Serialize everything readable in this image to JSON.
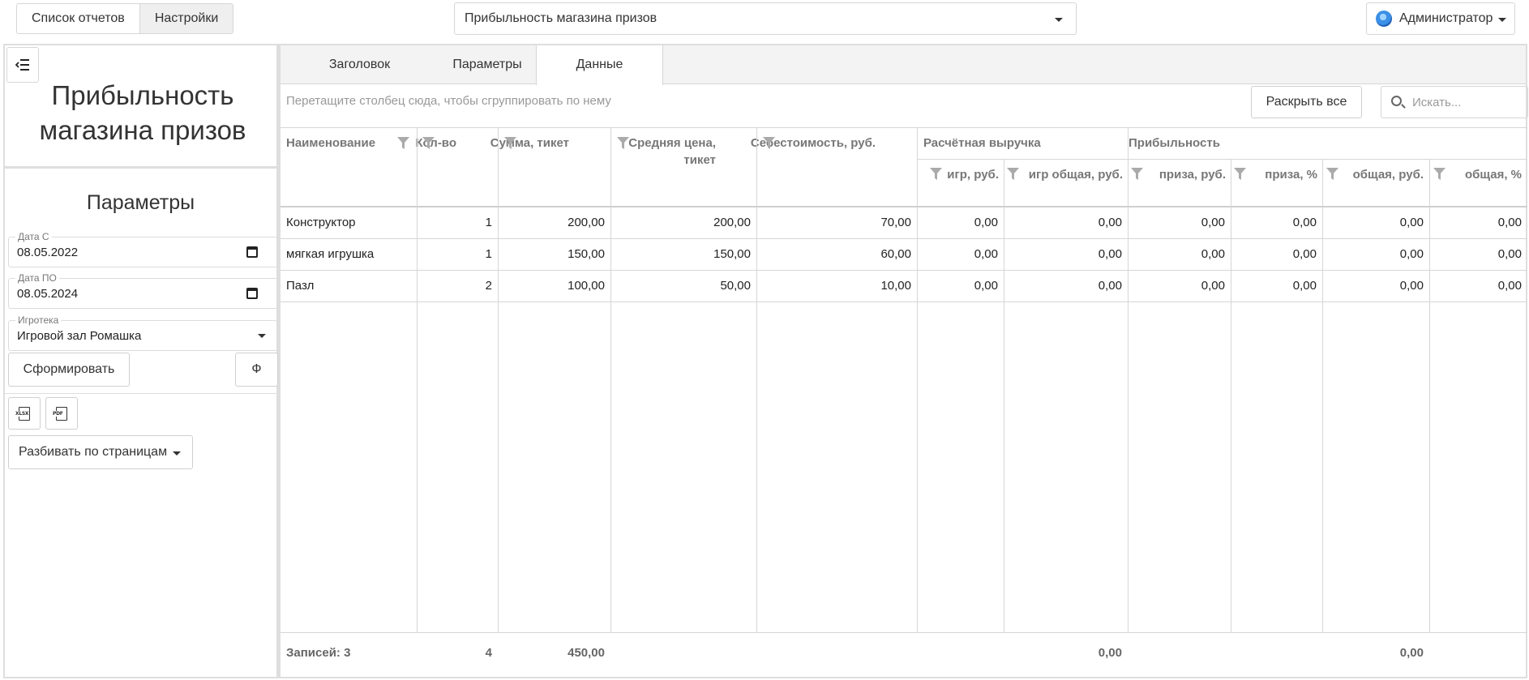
{
  "topbar": {
    "nav": [
      "Список отчетов",
      "Настройки"
    ],
    "report_select": "Прибыльность магазина призов",
    "user": "Администратор"
  },
  "left": {
    "title": "Прибыльность магазина призов",
    "params_title": "Параметры",
    "date_from_label": "Дата С",
    "date_from": "08.05.2022",
    "date_to_label": "Дата ПО",
    "date_to": "08.05.2024",
    "playroom_label": "Игротека",
    "playroom": "Игровой зал Ромашка",
    "generate_btn": "Сформировать",
    "f_btn": "Ф",
    "xlsx_label": "XLSX",
    "pdf_label": "PDF",
    "paging": "Разбивать по страницам"
  },
  "tabs": [
    "Заголовок",
    "Параметры",
    "Данные"
  ],
  "toolbar": {
    "group_hint": "Перетащите столбец сюда, чтобы сгруппировать по нему",
    "expand_all": "Раскрыть все",
    "search_placeholder": "Искать..."
  },
  "table": {
    "columns": [
      {
        "label": "Наименование"
      },
      {
        "label": "Кол-во"
      },
      {
        "label": "Сумма, тикет"
      },
      {
        "label": "Средняя цена, тикет"
      },
      {
        "label": "Себестоимость, руб."
      },
      {
        "label": "игр, руб."
      },
      {
        "label": "игр общая, руб."
      },
      {
        "label": "приза, руб."
      },
      {
        "label": "приза, %"
      },
      {
        "label": "общая, руб."
      },
      {
        "label": "общая, %"
      }
    ],
    "bands": [
      "Расчётная выручка",
      "Прибыльность"
    ],
    "rows": [
      [
        "Конструктор",
        "1",
        "200,00",
        "200,00",
        "70,00",
        "0,00",
        "0,00",
        "0,00",
        "0,00",
        "0,00",
        "0,00"
      ],
      [
        "мягкая игрушка",
        "1",
        "150,00",
        "150,00",
        "60,00",
        "0,00",
        "0,00",
        "0,00",
        "0,00",
        "0,00",
        "0,00"
      ],
      [
        "Пазл",
        "2",
        "100,00",
        "50,00",
        "10,00",
        "0,00",
        "0,00",
        "0,00",
        "0,00",
        "0,00",
        "0,00"
      ]
    ],
    "footer": {
      "records": "Записей: 3",
      "qty": "4",
      "sum": "450,00",
      "rev_total": "0,00",
      "profit_total": "0,00"
    }
  },
  "colors": {
    "border": "#d6d6d6",
    "header_text": "#777777",
    "tab_bg": "#f3f3f3"
  }
}
